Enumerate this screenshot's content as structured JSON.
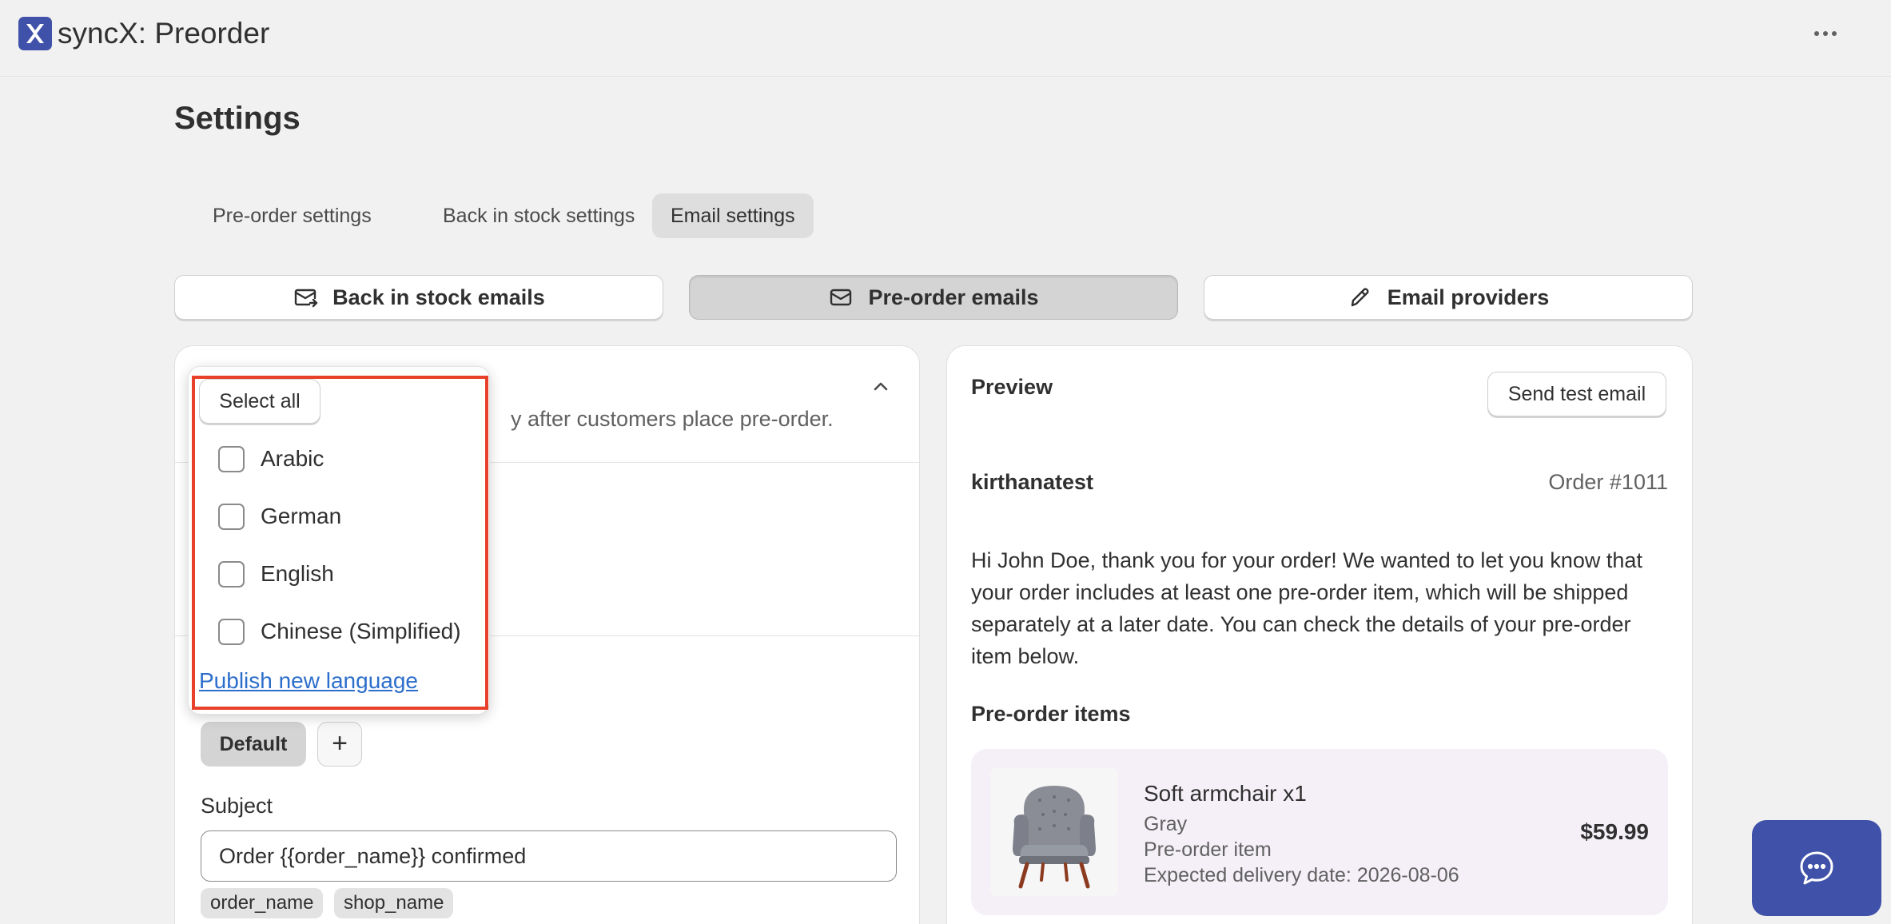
{
  "app": {
    "title": "syncX: Preorder",
    "logo_icon": "syncx-logo",
    "more_icon": "more-horizontal-icon"
  },
  "page": {
    "title": "Settings"
  },
  "tabs": [
    {
      "label": "Pre-order settings",
      "active": false
    },
    {
      "label": "Back in stock settings",
      "active": false
    },
    {
      "label": "Email settings",
      "active": true
    }
  ],
  "email_sections": [
    {
      "label": "Back in stock emails",
      "icon": "mail-arrow-icon",
      "active": false
    },
    {
      "label": "Pre-order emails",
      "icon": "mail-icon",
      "active": true
    },
    {
      "label": "Email providers",
      "icon": "pencil-icon",
      "active": false
    }
  ],
  "editor": {
    "description_visible_fragment": "y after customers place pre-order.",
    "default_chip": "Default",
    "add_chip": "+",
    "subject_label": "Subject",
    "subject_value": "Order {{order_name}} confirmed",
    "variables": [
      "order_name",
      "shop_name"
    ]
  },
  "language_dropdown": {
    "select_all_label": "Select all",
    "languages": [
      {
        "label": "Arabic",
        "checked": false
      },
      {
        "label": "German",
        "checked": false
      },
      {
        "label": "English",
        "checked": false
      },
      {
        "label": "Chinese (Simplified)",
        "checked": false
      }
    ],
    "publish_link": "Publish new language",
    "highlight_color": "#e8402a"
  },
  "preview": {
    "title": "Preview",
    "send_test_label": "Send test email",
    "shop_name": "kirthanatest",
    "order_number": "Order #1011",
    "body": "Hi John Doe, thank you for your order! We wanted to let you know that your order includes at least one pre-order item, which will be shipped separately at a later date. You can check the details of your pre-order item below.",
    "items_title": "Pre-order items",
    "item": {
      "name": "Soft armchair x1",
      "variant": "Gray",
      "tag": "Pre-order item",
      "delivery": "Expected delivery date: 2026-08-06",
      "price": "$59.99"
    }
  },
  "chat": {
    "icon": "chat-bubble-icon",
    "color": "#3f51a8"
  }
}
